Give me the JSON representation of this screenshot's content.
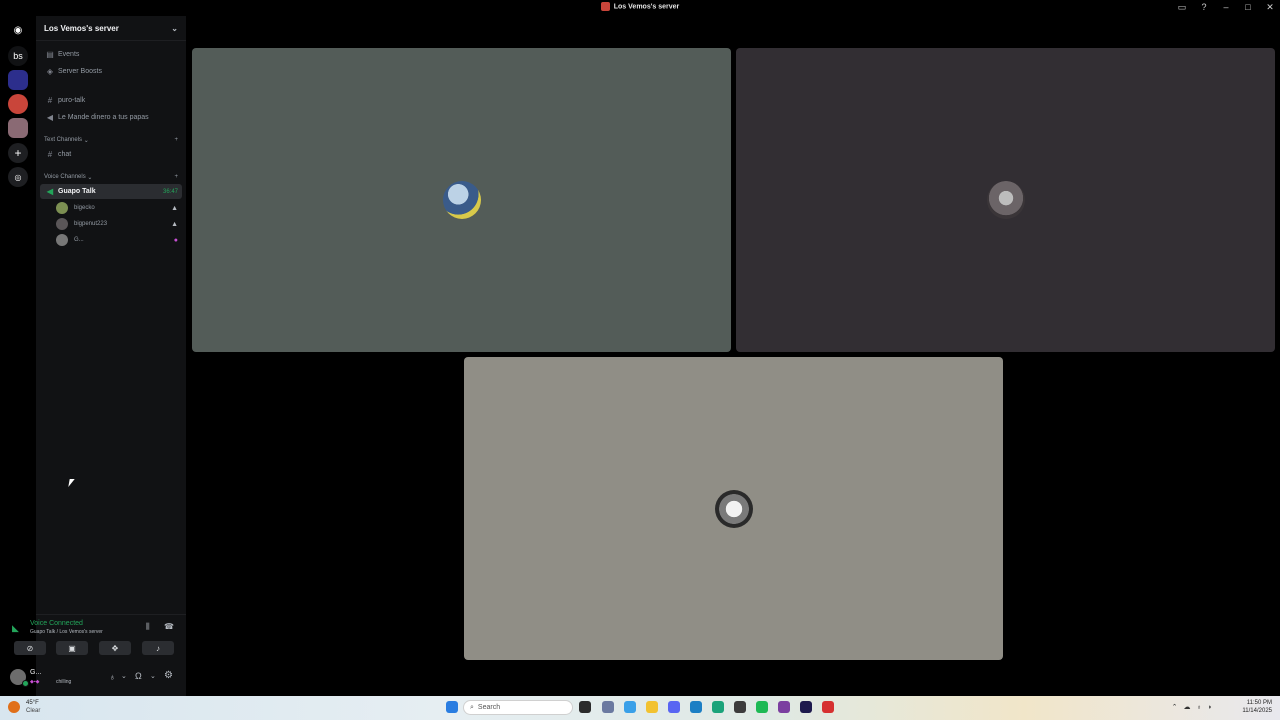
{
  "window": {
    "title": "Los Vemos's server"
  },
  "rail": {
    "home_initials": "bs"
  },
  "sidebar": {
    "server_name": "Los Vemos's server",
    "top_items": [
      {
        "label": "Events",
        "icon": "calendar-icon"
      },
      {
        "label": "Server Boosts",
        "icon": "boost-icon"
      }
    ],
    "pinned_channels": [
      {
        "label": "puro-talk",
        "icon": "hash-icon"
      },
      {
        "label": "Le Mande dinero a tus papas",
        "icon": "speaker-icon"
      }
    ],
    "text_category": "Text Channels",
    "text_channels": [
      {
        "label": "chat"
      }
    ],
    "voice_category": "Voice Channels",
    "voice_channel": {
      "label": "Guapo Talk",
      "timer": "36:47"
    },
    "voice_members": [
      {
        "name": "bigecko"
      },
      {
        "name": "bigpenut223"
      },
      {
        "name": "G..."
      }
    ]
  },
  "voice_panel": {
    "status": "Voice Connected",
    "location": "Guapo Talk / Los Vemos's server"
  },
  "user_panel": {
    "name": "G...",
    "status": "chilling"
  },
  "taskbar": {
    "weather_temp": "45°F",
    "weather_desc": "Clear",
    "search_placeholder": "Search",
    "time": "11:50 PM",
    "date": "11/14/2025"
  },
  "colors": {
    "tile1": "#535c58",
    "tile2": "#322e33",
    "tile3": "#908e86",
    "accent_green": "#23a55a"
  }
}
